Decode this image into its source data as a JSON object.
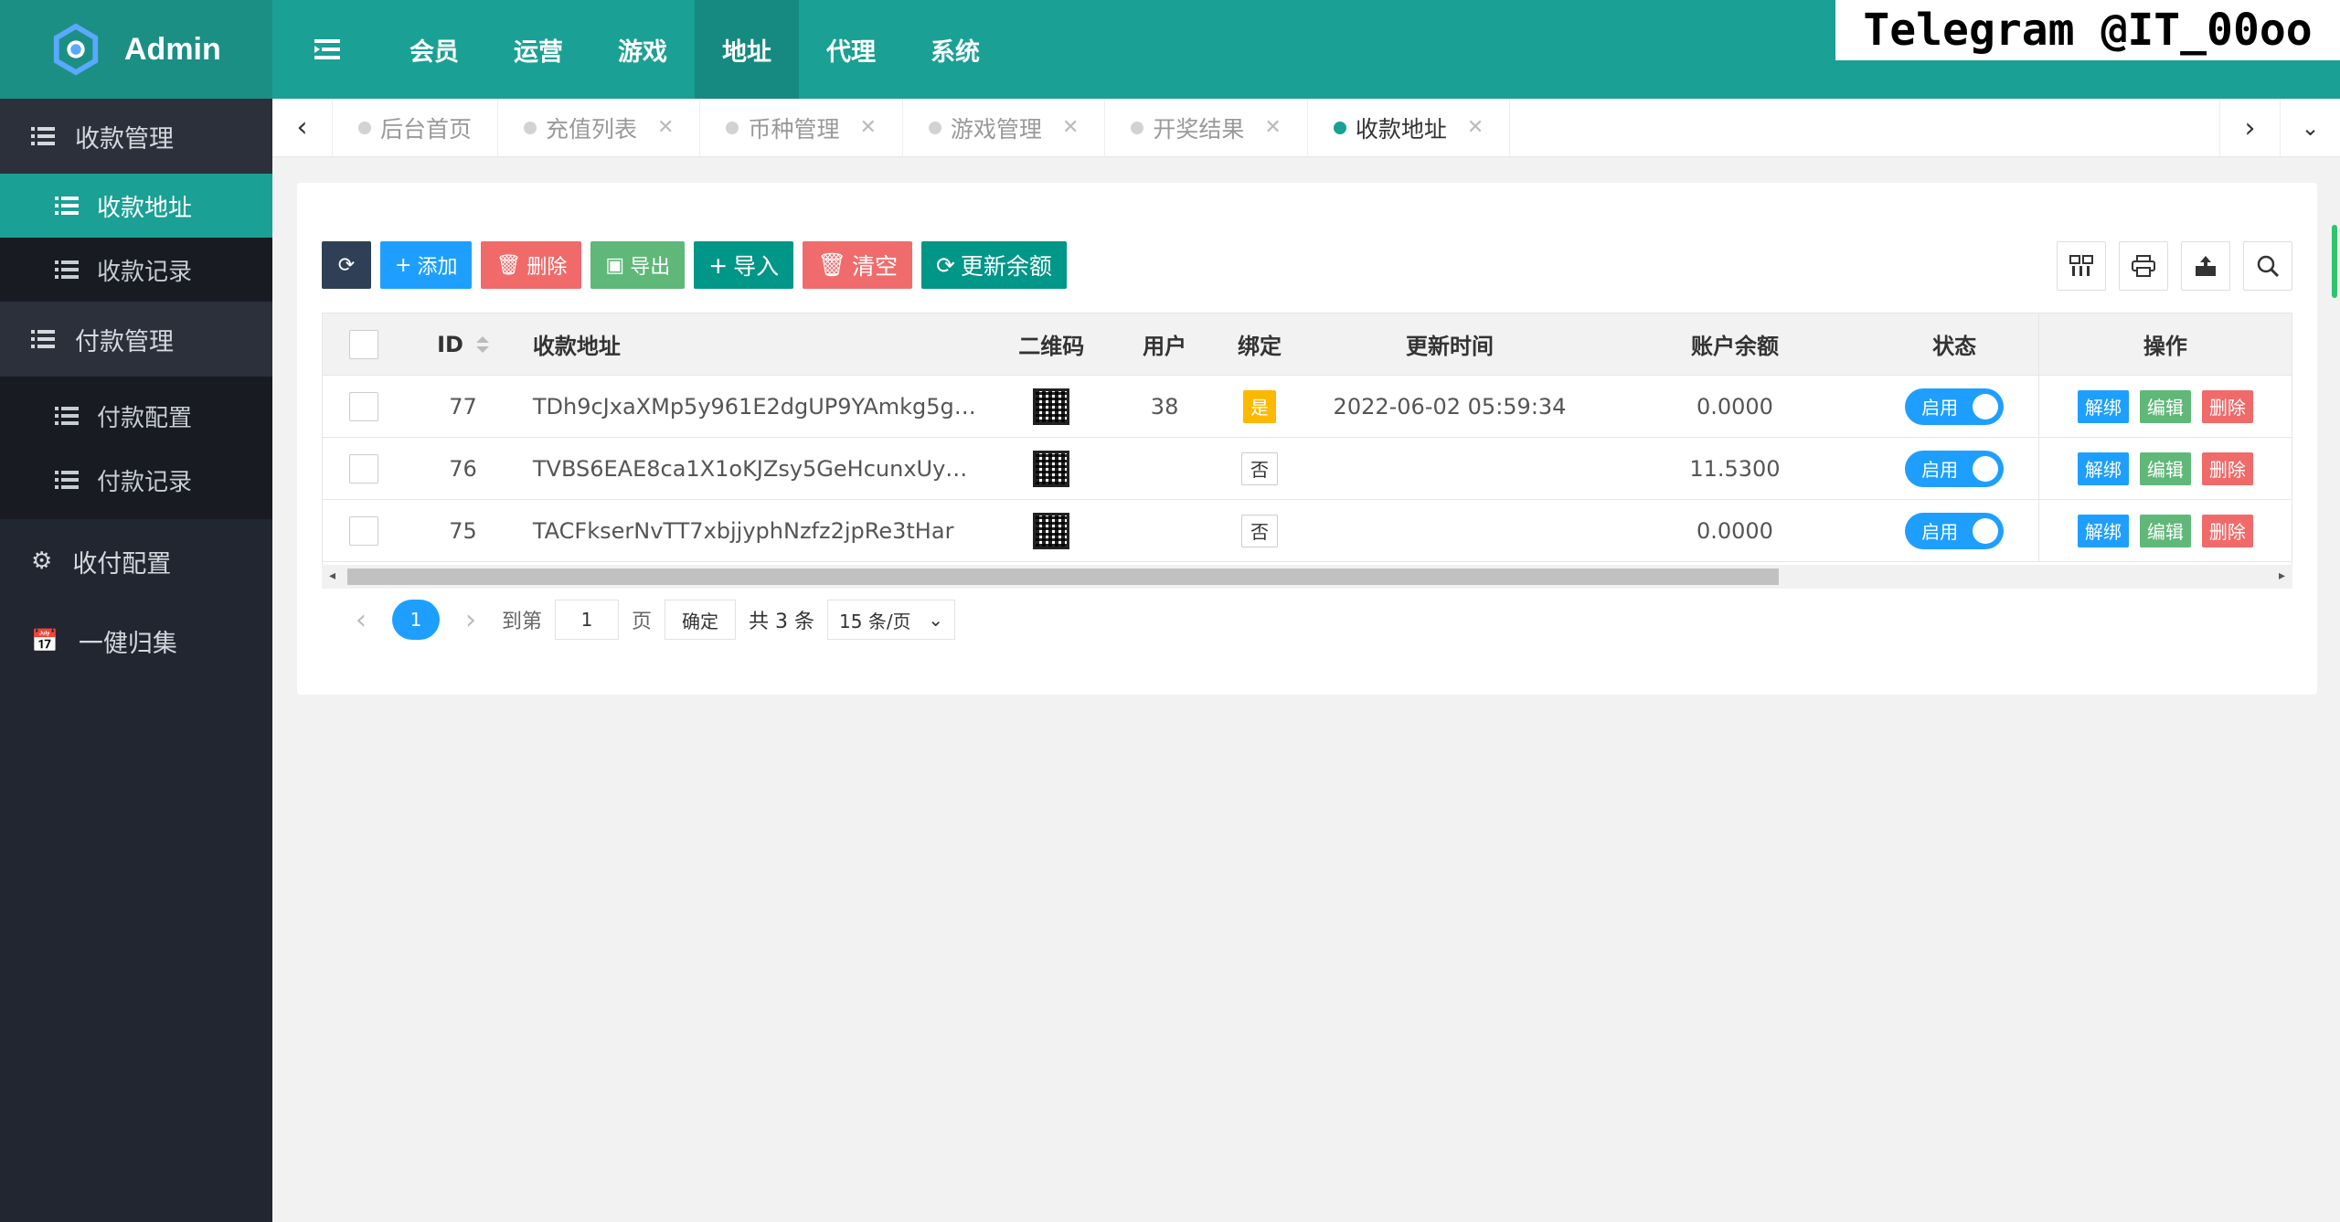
{
  "app": {
    "logo_text": "Admin"
  },
  "sidebar": {
    "groups": [
      {
        "label": "收款管理",
        "items": [
          {
            "label": "收款地址",
            "active": true
          },
          {
            "label": "收款记录",
            "active": false
          }
        ]
      },
      {
        "label": "付款管理",
        "items": [
          {
            "label": "付款配置",
            "active": false
          },
          {
            "label": "付款记录",
            "active": false
          }
        ]
      },
      {
        "label": "收付配置"
      },
      {
        "label": "一健归集"
      }
    ]
  },
  "topnav": {
    "items": [
      "会员",
      "运营",
      "游戏",
      "地址",
      "代理",
      "系统"
    ],
    "active_index": 3
  },
  "banner": {
    "text": "Telegram @IT_00oo"
  },
  "tabs": [
    {
      "label": "后台首页",
      "closable": false
    },
    {
      "label": "充值列表",
      "closable": true
    },
    {
      "label": "币种管理",
      "closable": true
    },
    {
      "label": "游戏管理",
      "closable": true
    },
    {
      "label": "开奖结果",
      "closable": true
    },
    {
      "label": "收款地址",
      "closable": true,
      "active": true
    }
  ],
  "toolbar": {
    "add": "添加",
    "delete": "删除",
    "export": "导出",
    "import": "导入",
    "clear": "清空",
    "refresh_balance": "更新余额"
  },
  "table": {
    "columns": [
      "ID",
      "收款地址",
      "二维码",
      "用户",
      "绑定",
      "更新时间",
      "账户余额",
      "状态",
      "操作"
    ],
    "rows": [
      {
        "id": "77",
        "address": "TDh9cJxaXMp5y961E2dgUP9YAmkg5g…",
        "user": "38",
        "bound": "是",
        "bound_yes": true,
        "updated": "2022-06-02 05:59:34",
        "balance": "0.0000",
        "status": "启用"
      },
      {
        "id": "76",
        "address": "TVBS6EAE8ca1X1oKJZsy5GeHcunxUy…",
        "user": "",
        "bound": "否",
        "bound_yes": false,
        "updated": "",
        "balance": "11.5300",
        "status": "启用"
      },
      {
        "id": "75",
        "address": "TACFkserNvTT7xbjjyphNzfz2jpRe3tHar",
        "user": "",
        "bound": "否",
        "bound_yes": false,
        "updated": "",
        "balance": "0.0000",
        "status": "启用"
      }
    ],
    "ops": {
      "unbind": "解绑",
      "edit": "编辑",
      "delete": "删除"
    }
  },
  "pager": {
    "current": "1",
    "goto_label": "到第",
    "goto_value": "1",
    "page_label": "页",
    "confirm": "确定",
    "total": "共 3 条",
    "page_size": "15 条/页"
  },
  "colors": {
    "brand": "#1aa094",
    "sidebar": "#222631",
    "blue": "#1e9fff"
  }
}
